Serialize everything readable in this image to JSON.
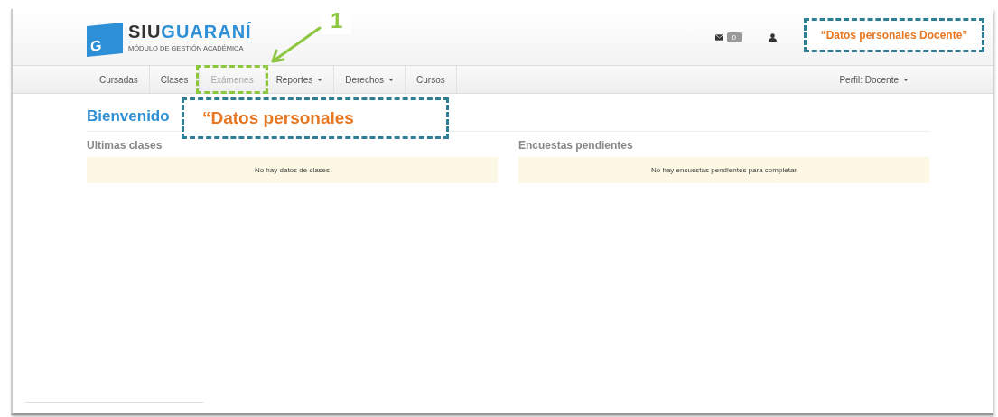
{
  "logo": {
    "letter": "G",
    "brand_first": "SIU",
    "brand_second": "GUARANÍ",
    "subtitle": "MÓDULO DE GESTIÓN ACADÉMICA"
  },
  "header": {
    "messages_count": "0"
  },
  "nav": [
    {
      "label": "Cursadas",
      "disabled": false,
      "dropdown": false
    },
    {
      "label": "Clases",
      "disabled": false,
      "dropdown": false
    },
    {
      "label": "Exámenes",
      "disabled": true,
      "dropdown": false
    },
    {
      "label": "Reportes",
      "disabled": false,
      "dropdown": true
    },
    {
      "label": "Derechos",
      "disabled": false,
      "dropdown": true
    },
    {
      "label": "Cursos",
      "disabled": false,
      "dropdown": false
    }
  ],
  "profile": {
    "label": "Perfil: Docente"
  },
  "welcome": "Bienvenido",
  "panels": [
    {
      "title": "Ultimas clases",
      "message": "No hay datos de clases"
    },
    {
      "title": "Encuestas pendientes",
      "message": "No hay encuestas pendientes para completar"
    }
  ],
  "annotations": [
    {
      "kind": "step",
      "label": "1"
    },
    {
      "kind": "note",
      "label": "“Datos personales Docente”"
    },
    {
      "kind": "callout",
      "label": "“Datos personales"
    }
  ]
}
